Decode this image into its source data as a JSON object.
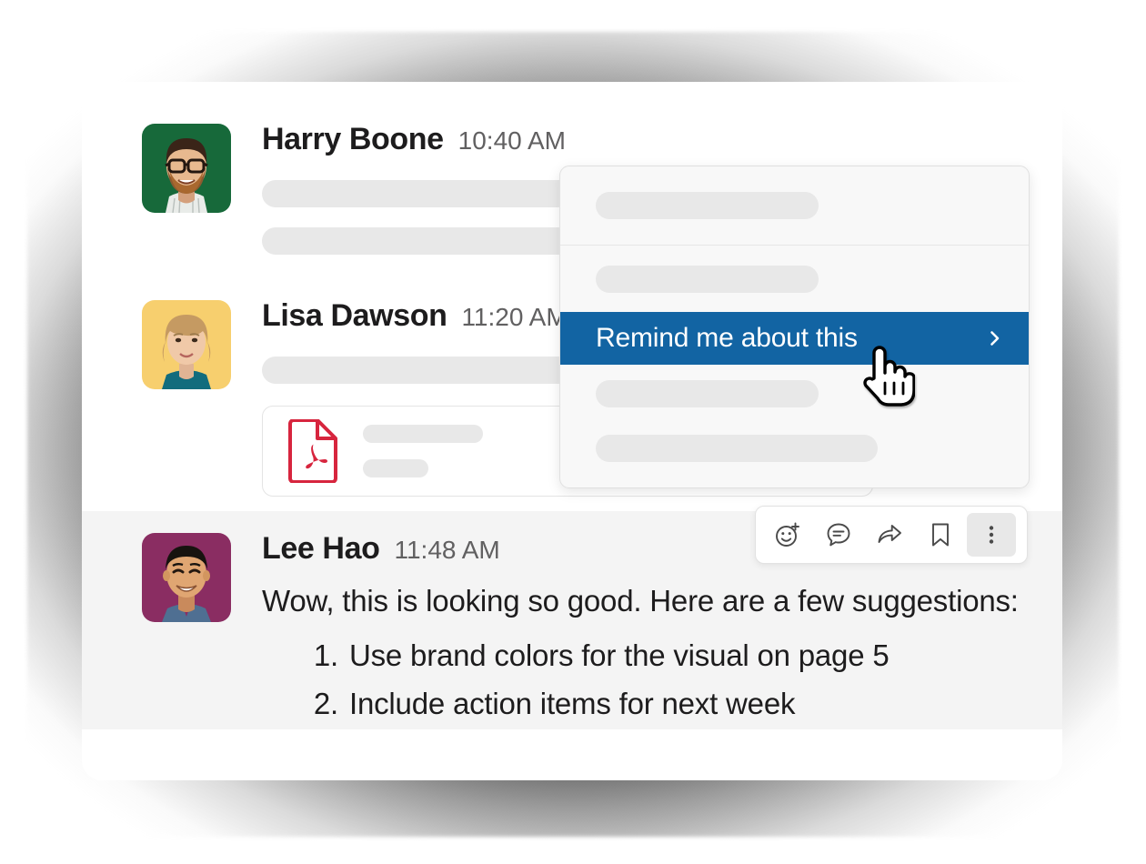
{
  "messages": [
    {
      "author": "Harry Boone",
      "time": "10:40 AM",
      "avatar_name": "avatar-harry-boone",
      "avatar_bg": "#17693a",
      "body_placeholder": true
    },
    {
      "author": "Lisa Dawson",
      "time": "11:20 AM",
      "avatar_name": "avatar-lisa-dawson",
      "avatar_bg": "#f7cf6e",
      "attachment": {
        "icon": "pdf-file-icon",
        "icon_color": "#d7253e",
        "placeholder": true
      }
    },
    {
      "author": "Lee Hao",
      "time": "11:48 AM",
      "avatar_name": "avatar-lee-hao",
      "avatar_bg": "#8a2d62",
      "text": "Wow, this is looking so good. Here are a few suggestions:",
      "list": [
        "Use brand colors for the visual on page 5",
        "Include action items for next week"
      ],
      "highlighted": true
    }
  ],
  "context_menu": {
    "active_item": {
      "label": "Remind me about this",
      "chevron": "chevron-right-icon",
      "highlight_color": "#1264a3",
      "text_color": "#ffffff"
    },
    "skeleton_rows": 4
  },
  "action_toolbar": {
    "buttons": [
      {
        "name": "add-reaction-button",
        "icon": "emoji-plus-icon",
        "active": false
      },
      {
        "name": "reply-in-thread-button",
        "icon": "comment-icon",
        "active": false
      },
      {
        "name": "forward-message-button",
        "icon": "share-arrow-icon",
        "active": false
      },
      {
        "name": "save-message-button",
        "icon": "bookmark-icon",
        "active": false
      },
      {
        "name": "more-actions-button",
        "icon": "more-vertical-icon",
        "active": true
      }
    ]
  },
  "cursor": {
    "type": "pointing-hand-cursor"
  },
  "colors": {
    "accent": "#1264a3",
    "card_bg": "#ffffff",
    "highlight_band": "#f4f4f4",
    "skeleton": "#e8e8e8",
    "text_primary": "#1d1c1d",
    "text_secondary": "#616061"
  }
}
